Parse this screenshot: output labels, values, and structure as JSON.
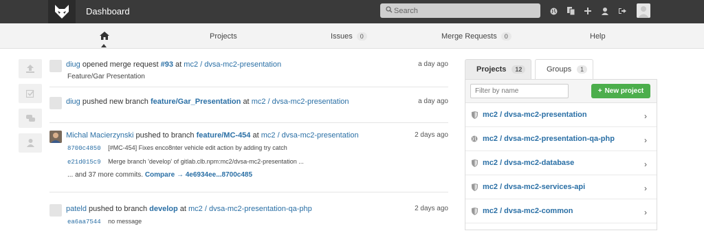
{
  "topbar": {
    "title": "Dashboard",
    "search_placeholder": "Search",
    "icons": [
      "globe-icon",
      "copy-icon",
      "plus-icon",
      "user-icon",
      "sign-out-icon"
    ]
  },
  "nav": {
    "home_icon": "home-icon",
    "projects": "Projects",
    "issues": "Issues",
    "issues_count": "0",
    "merge_requests": "Merge Requests",
    "merge_requests_count": "0",
    "help": "Help"
  },
  "side_filters": [
    "upload-icon",
    "check-icon",
    "comments-icon",
    "user-icon"
  ],
  "events": [
    {
      "author": "diug",
      "action": "opened merge request",
      "target": "#93",
      "at": "at",
      "project": "mc2 / dvsa-mc2-presentation",
      "time": "a day ago",
      "body": "Feature/Gar Presentation"
    },
    {
      "author": "diug",
      "action": "pushed new branch",
      "target": "feature/Gar_Presentation",
      "at": "at",
      "project": "mc2 / dvsa-mc2-presentation",
      "time": "a day ago"
    },
    {
      "author": "Michal Macierzynski",
      "action": "pushed to branch",
      "target": "feature/MC-454",
      "at": "at",
      "project": "mc2 / dvsa-mc2-presentation",
      "time": "2 days ago",
      "commits": [
        {
          "sha": "8700c4850",
          "message": "[#MC-454] Fixes enco8nter vehicle edit action by adding try catch"
        },
        {
          "sha": "e21d015c9",
          "message": "Merge branch 'develop' of gitlab.clb.npm:mc2/dvsa-mc2-presentation ..."
        }
      ],
      "more": "... and 37 more commits.",
      "compare": "Compare → 4e6934ee...8700c485"
    },
    {
      "author": "pateld",
      "action": "pushed to branch",
      "target": "develop",
      "at": "at",
      "project": "mc2 / dvsa-mc2-presentation-qa-php",
      "time": "2 days ago",
      "commits": [
        {
          "sha": "ea6aa7544",
          "message": "no message"
        }
      ]
    }
  ],
  "panel": {
    "tab_projects": "Projects",
    "projects_count": "12",
    "tab_groups": "Groups",
    "groups_count": "1",
    "filter_placeholder": "Filter by name",
    "new_project": "New project",
    "projects": [
      {
        "name": "mc2 / dvsa-mc2-presentation",
        "icon": "shield-icon"
      },
      {
        "name": "mc2 / dvsa-mc2-presentation-qa-php",
        "icon": "globe-icon"
      },
      {
        "name": "mc2 / dvsa-mc2-database",
        "icon": "shield-icon"
      },
      {
        "name": "mc2 / dvsa-mc2-services-api",
        "icon": "shield-icon"
      },
      {
        "name": "mc2 / dvsa-mc2-common",
        "icon": "shield-icon"
      }
    ]
  }
}
